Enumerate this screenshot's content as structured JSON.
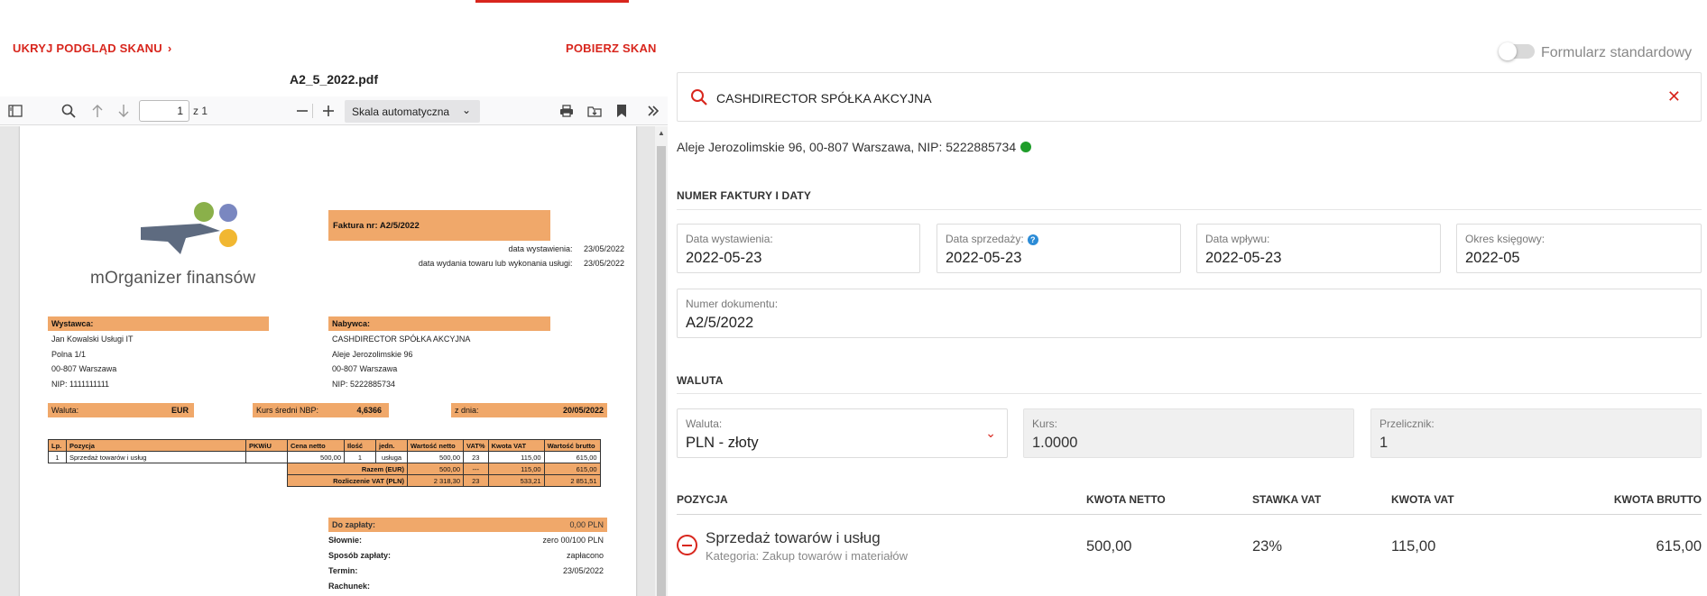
{
  "left_panel": {
    "hide_scan": "UKRYJ PODGLĄD SKANU",
    "download_scan": "POBIERZ SKAN",
    "pdf_name": "A2_5_2022.pdf",
    "toolbar": {
      "page": "1",
      "page_of": "z 1",
      "zoom": "Skala automatyczna"
    },
    "invoice": {
      "logo_text": "mOrganizer finansów",
      "title": "Faktura nr: A2/5/2022",
      "issue_label": "data wystawienia:",
      "issue_date": "23/05/2022",
      "delivery_label": "data wydania towaru lub wykonania usługi:",
      "delivery_date": "23/05/2022",
      "seller_title": "Wystawca:",
      "seller": [
        "Jan Kowalski Usługi IT",
        "Polna 1/1",
        "00-807 Warszawa",
        "NIP: 1111111111"
      ],
      "buyer_title": "Nabywca:",
      "buyer": [
        "CASHDIRECTOR SPÓŁKA AKCYJNA",
        "Aleje Jerozolimskie 96",
        "00-807 Warszawa",
        "NIP: 5222885734"
      ],
      "currency_label": "Waluta:",
      "currency": "EUR",
      "rate_label": "Kurs średni NBP:",
      "rate": "4,6366",
      "rate_date_label": "z dnia:",
      "rate_date": "20/05/2022",
      "table_headers": [
        "Lp.",
        "Pozycja",
        "PKWiU",
        "Cena netto",
        "Ilość",
        "jedn.",
        "Wartość netto",
        "VAT%",
        "Kwota VAT",
        "Wartość brutto"
      ],
      "rows": [
        [
          "1",
          "Sprzedaż towarów i usług",
          "",
          "500,00",
          "1",
          "usługa",
          "500,00",
          "23",
          "115,00",
          "615,00"
        ]
      ],
      "total_label": "Razem (EUR)",
      "total": [
        "500,00",
        "---",
        "115,00",
        "615,00"
      ],
      "vat_label": "Rozliczenie VAT (PLN)",
      "vat": [
        "2 318,30",
        "23",
        "533,21",
        "2 851,51"
      ],
      "to_pay_label": "Do zapłaty:",
      "to_pay": "0,00 PLN",
      "words_label": "Słownie:",
      "words": "zero 00/100 PLN",
      "method_label": "Sposób zapłaty:",
      "method": "zapłacono",
      "term_label": "Termin:",
      "term": "23/05/2022",
      "account_label": "Rachunek:"
    }
  },
  "right_panel": {
    "standard_form": "Formularz standardowy",
    "contractor": "CASHDIRECTOR SPÓŁKA AKCYJNA",
    "address": "Aleje Jerozolimskie 96, 00-807 Warszawa, NIP: 5222885734",
    "section_dates": "NUMER FAKTURY I DATY",
    "issue_date_label": "Data wystawienia:",
    "issue_date": "2022-05-23",
    "sale_date_label": "Data sprzedaży:",
    "sale_date": "2022-05-23",
    "receipt_date_label": "Data wpływu:",
    "receipt_date": "2022-05-23",
    "period_label": "Okres księgowy:",
    "period": "2022-05",
    "doc_number_label": "Numer dokumentu:",
    "doc_number": "A2/5/2022",
    "section_currency": "WALUTA",
    "currency_label": "Waluta:",
    "currency": "PLN - złoty",
    "rate_label": "Kurs:",
    "rate": "1.0000",
    "converter_label": "Przelicznik:",
    "converter": "1",
    "columns": {
      "position": "POZYCJA",
      "net": "KWOTA NETTO",
      "vat_rate": "STAWKA VAT",
      "vat": "KWOTA VAT",
      "gross": "KWOTA BRUTTO"
    },
    "item": {
      "name": "Sprzedaż towarów i usług",
      "category": "Kategoria: Zakup towarów i materiałów",
      "net": "500,00",
      "vat_rate": "23%",
      "vat": "115,00",
      "gross": "615,00"
    }
  },
  "colors": {
    "accent": "#d8261d",
    "invoice_orange": "#f0a86a",
    "status_green": "#1f9d2a"
  }
}
